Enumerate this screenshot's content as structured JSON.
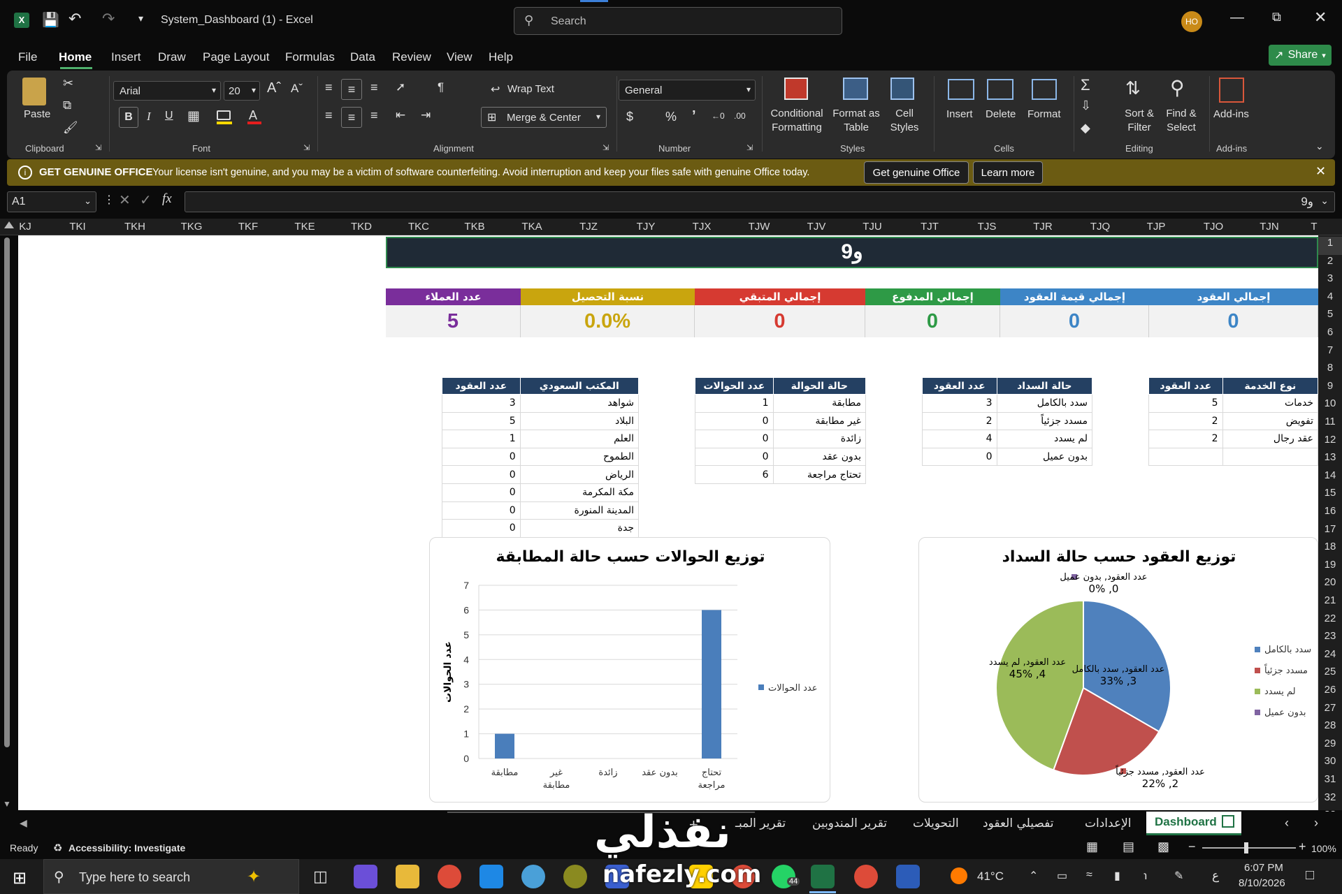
{
  "app": {
    "title": "System_Dashboard (1)  -  Excel",
    "search_placeholder": "Search",
    "avatar_initials": "HO",
    "share_label": "Share"
  },
  "menu": [
    "File",
    "Home",
    "Insert",
    "Draw",
    "Page Layout",
    "Formulas",
    "Data",
    "Review",
    "View",
    "Help"
  ],
  "ribbon": {
    "paste": "Paste",
    "clipboard": "Clipboard",
    "font_name": "Arial",
    "font_size": "20",
    "font": "Font",
    "wrap_text": "Wrap Text",
    "merge_center": "Merge & Center",
    "alignment": "Alignment",
    "number_format": "General",
    "number": "Number",
    "conditional_formatting_1": "Conditional",
    "conditional_formatting_2": "Formatting",
    "format_as_table_1": "Format as",
    "format_as_table_2": "Table",
    "cell_styles_1": "Cell",
    "cell_styles_2": "Styles",
    "styles": "Styles",
    "insert": "Insert",
    "delete": "Delete",
    "format": "Format",
    "cells": "Cells",
    "sort_filter_1": "Sort &",
    "sort_filter_2": "Filter",
    "find_select_1": "Find &",
    "find_select_2": "Select",
    "editing": "Editing",
    "addins": "Add-ins",
    "addins_group": "Add-ins"
  },
  "message_bar": {
    "title": "GET GENUINE OFFICE",
    "text": "Your license isn't genuine, and you may be a victim of software counterfeiting. Avoid interruption and keep your files safe with genuine Office today.",
    "btn_genuine": "Get genuine Office",
    "btn_learn": "Learn more"
  },
  "formula_bar": {
    "name_box": "A1",
    "fx": "fx",
    "value": "9و"
  },
  "columns": [
    "KJ",
    "TKI",
    "TKH",
    "TKG",
    "TKF",
    "TKE",
    "TKD",
    "TKC",
    "TKB",
    "TKA",
    "TJZ",
    "TJY",
    "TJX",
    "TJW",
    "TJV",
    "TJU",
    "TJT",
    "TJS",
    "TJR",
    "TJQ",
    "TJP",
    "TJO",
    "TJN",
    "T"
  ],
  "rows": [
    "1",
    "2",
    "3",
    "4",
    "5",
    "6",
    "7",
    "8",
    "9",
    "10",
    "11",
    "12",
    "13",
    "14",
    "15",
    "16",
    "17",
    "18",
    "19",
    "20",
    "21",
    "22",
    "23",
    "24",
    "25",
    "26",
    "27",
    "28",
    "29",
    "30",
    "31",
    "32",
    "33"
  ],
  "sheet": {
    "banner": "9و",
    "kpis": [
      {
        "label": "إجمالي العقود",
        "value": "0",
        "color": "#3d85c6",
        "value_color": "#3d85c6"
      },
      {
        "label": "إجمالي قيمة العقود",
        "value": "0",
        "color": "#3d85c6",
        "value_color": "#3d85c6"
      },
      {
        "label": "إجمالي المدفوع",
        "value": "0",
        "color": "#2e9a46",
        "value_color": "#2e9a46"
      },
      {
        "label": "إجمالي المتبقي",
        "value": "0",
        "color": "#d63a31",
        "value_color": "#d63a31"
      },
      {
        "label": "نسبة التحصيل",
        "value": "0.0%",
        "color": "#c9a50e",
        "value_color": "#c9a50e"
      },
      {
        "label": "عدد العملاء",
        "value": "5",
        "color": "#7a2e9b",
        "value_color": "#7a2e9b"
      }
    ],
    "table_service": {
      "headers": [
        "نوع الخدمة",
        "عدد العقود"
      ],
      "rows": [
        [
          "خدمات",
          "5"
        ],
        [
          "تفويض",
          "2"
        ],
        [
          "عقد رجال",
          "2"
        ],
        [
          "",
          ""
        ]
      ]
    },
    "table_payment": {
      "headers": [
        "حالة السداد",
        "عدد العقود"
      ],
      "rows": [
        [
          "سدد بالكامل",
          "3"
        ],
        [
          "مسدد جزئياً",
          "2"
        ],
        [
          "لم يسدد",
          "4"
        ],
        [
          "بدون عميل",
          "0"
        ]
      ]
    },
    "table_transfer": {
      "headers": [
        "حالة الحوالة",
        "عدد الحوالات"
      ],
      "rows": [
        [
          "مطابقة",
          "1"
        ],
        [
          "غير مطابقة",
          "0"
        ],
        [
          "زائدة",
          "0"
        ],
        [
          "بدون عقد",
          "0"
        ],
        [
          "تحتاج مراجعة",
          "6"
        ]
      ]
    },
    "table_office": {
      "headers": [
        "المكتب السعودي",
        "عدد العقود"
      ],
      "rows": [
        [
          "شواهد",
          "3"
        ],
        [
          "البلاد",
          "5"
        ],
        [
          "العلم",
          "1"
        ],
        [
          "الطموح",
          "0"
        ],
        [
          "الرياض",
          "0"
        ],
        [
          "مكة المكرمة",
          "0"
        ],
        [
          "المدينة المنورة",
          "0"
        ],
        [
          "جدة",
          "0"
        ]
      ]
    }
  },
  "chart_data": [
    {
      "type": "bar",
      "title": "توزيع الحوالات حسب حالة المطابقة",
      "categories": [
        "مطابقة",
        "غير مطابقة",
        "زائدة",
        "بدون عقد",
        "تحتاج مراجعة"
      ],
      "series": [
        {
          "name": "عدد الحوالات",
          "values": [
            1,
            0,
            0,
            0,
            6
          ],
          "color": "#4a7ebb"
        }
      ],
      "ylabel": "عدد الحوالات",
      "ylim": [
        0,
        7
      ],
      "yticks": [
        "0",
        "1",
        "2",
        "3",
        "4",
        "5",
        "6",
        "7"
      ],
      "grid": true,
      "legend": "right"
    },
    {
      "type": "pie",
      "title": "توزيع العقود حسب حالة السداد",
      "categories": [
        "سدد بالكامل",
        "مسدد جزئياً",
        "لم يسدد",
        "بدون عميل"
      ],
      "values": [
        3,
        2,
        4,
        0
      ],
      "colors": [
        "#4f81bd",
        "#c0504d",
        "#9bbb59",
        "#8064a2"
      ],
      "data_labels": [
        "عدد العقود, سدد بالكامل, 3, 33%",
        "عدد العقود, مسدد جزئياً, 2, 22%",
        "عدد العقود, لم يسدد, 4, 45%",
        "عدد العقود, بدون عميل, 0, 0%"
      ],
      "legend": "right"
    }
  ],
  "sheet_tabs": [
    "Dashboard",
    "الإعدادات",
    "تفصيلي العقود",
    "التحويلات",
    "تقرير المندوبين",
    "تقرير المبـ"
  ],
  "status": {
    "ready": "Ready",
    "accessibility": "Accessibility: Investigate",
    "zoom": "100%"
  },
  "taskbar": {
    "search_placeholder": "Type here to search",
    "temperature": "41°C",
    "lang": "ع",
    "time": "6:07 PM",
    "date": "8/10/2026",
    "whatsapp_badge": "44"
  },
  "watermark": {
    "arabic": "نفذلي",
    "latin": "nafezly.com"
  }
}
